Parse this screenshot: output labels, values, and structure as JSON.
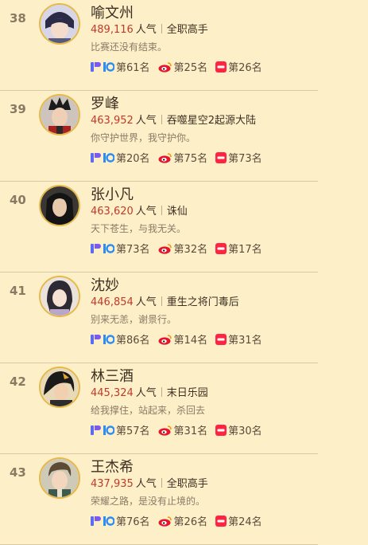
{
  "labels": {
    "popularity_suffix": "人气"
  },
  "rows": [
    {
      "rank": "38",
      "name": "喻文州",
      "popularity": "489,116",
      "work": "全职高手",
      "quote": "比赛还没有结束。",
      "r1": "第61名",
      "r2": "第25名",
      "r3": "第26名"
    },
    {
      "rank": "39",
      "name": "罗峰",
      "popularity": "463,952",
      "work": "吞噬星空2起源大陆",
      "quote": "你守护世界，我守护你。",
      "r1": "第20名",
      "r2": "第75名",
      "r3": "第73名"
    },
    {
      "rank": "40",
      "name": "张小凡",
      "popularity": "463,620",
      "work": "诛仙",
      "quote": "天下苍生，与我无关。",
      "r1": "第73名",
      "r2": "第32名",
      "r3": "第17名"
    },
    {
      "rank": "41",
      "name": "沈妙",
      "popularity": "446,854",
      "work": "重生之将门毒后",
      "quote": "别来无恙，谢景行。",
      "r1": "第86名",
      "r2": "第14名",
      "r3": "第31名"
    },
    {
      "rank": "42",
      "name": "林三酒",
      "popularity": "445,324",
      "work": "末日乐园",
      "quote": "给我撑住，站起来，杀回去",
      "r1": "第57名",
      "r2": "第31名",
      "r3": "第30名"
    },
    {
      "rank": "43",
      "name": "王杰希",
      "popularity": "437,935",
      "work": "全职高手",
      "quote": "荣耀之路，是没有止境的。",
      "r1": "第76名",
      "r2": "第26名",
      "r3": "第24名"
    }
  ],
  "icons": {
    "platform1": "blue-purple-logo-icon",
    "platform2": "weibo-icon",
    "platform3": "red-app-icon"
  },
  "colors": {
    "background": "#fdf0c9",
    "popularity": "#c0392b",
    "divider": "#d9c8a4",
    "avatar_ring": "#e6b84a"
  }
}
